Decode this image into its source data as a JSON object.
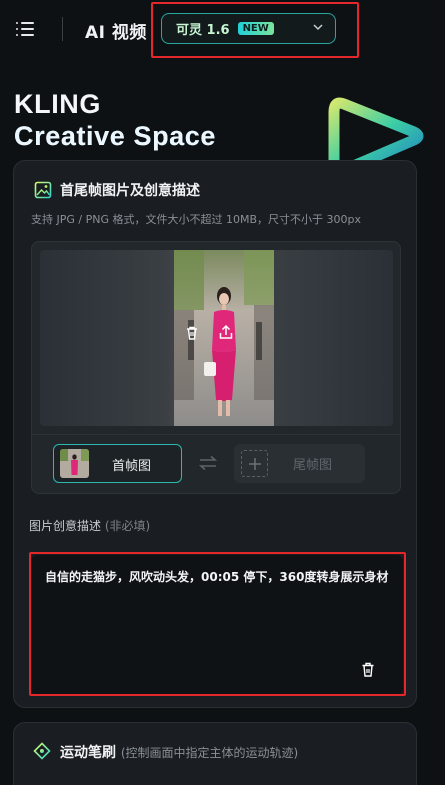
{
  "header": {
    "title": "AI 视频",
    "model_name": "可灵 1.6",
    "model_badge": "NEW"
  },
  "hero": {
    "line1": "KLING",
    "line2": "Creative Space"
  },
  "upload_section": {
    "title": "首尾帧图片及创意描述",
    "hint": "支持 JPG / PNG 格式，文件大小不超过 10MB，尺寸不小于 300px",
    "first_frame_label": "首帧图",
    "last_frame_label": "尾帧图"
  },
  "description": {
    "label": "图片创意描述",
    "optional": "(非必填)",
    "value": "自信的走猫步，风吹动头发，00:05 停下，360度转身展示身材"
  },
  "motion_brush": {
    "title": "运动笔刷",
    "subtitle": "(控制画面中指定主体的运动轨迹)"
  },
  "colors": {
    "accent": "#2aa6a0",
    "highlight_outline": "#e5262a",
    "background": "#0e1114"
  },
  "icons": [
    "menu-icon",
    "chevron-down-icon",
    "image-icon",
    "delete-icon",
    "upload-icon",
    "swap-icon",
    "plus-icon",
    "trash-icon",
    "motion-brush-icon"
  ]
}
